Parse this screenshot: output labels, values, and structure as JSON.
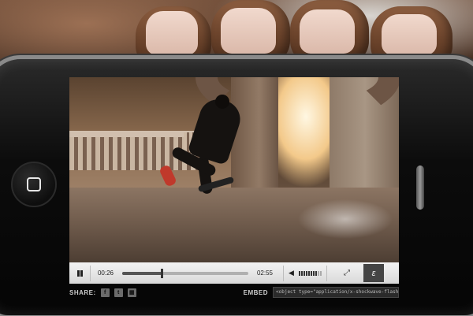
{
  "player": {
    "elapsed": "00:26",
    "duration": "02:55",
    "progress_fraction": 0.31,
    "volume_level": 0.8,
    "logo_glyph": "ε"
  },
  "share": {
    "label": "SHARE:",
    "buttons": [
      {
        "icon": "facebook-icon",
        "glyph": "f"
      },
      {
        "icon": "twitter-icon",
        "glyph": "t"
      },
      {
        "icon": "grid-icon",
        "glyph": "▦"
      }
    ]
  },
  "embed": {
    "label": "EMBED",
    "code": "<object type=\"application/x-shockwave-flash\" data"
  }
}
